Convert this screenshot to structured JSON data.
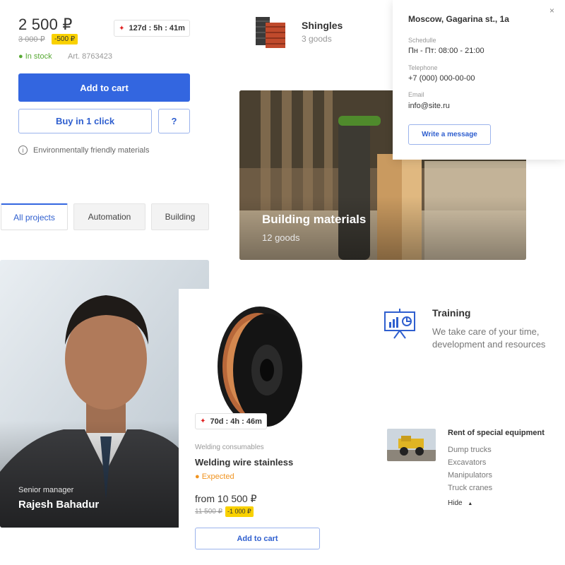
{
  "product": {
    "price": "2 500 ₽",
    "old_price": "3 000 ₽",
    "discount": "-500 ₽",
    "timer": "127d : 5h : 41m",
    "stock": "● In stock",
    "article": "Art. 8763423",
    "add_to_cart": "Add to cart",
    "buy_one_click": "Buy in 1 click",
    "question": "?",
    "eco_note": "Environmentally friendly materials"
  },
  "tabs": [
    {
      "label": "All projects",
      "active": true
    },
    {
      "label": "Automation",
      "active": false
    },
    {
      "label": "Building",
      "active": false
    }
  ],
  "shingles": {
    "title": "Shingles",
    "count": "3 goods"
  },
  "building_materials": {
    "title": "Building materials",
    "count": "12 goods"
  },
  "contact_popup": {
    "address": "Moscow, Gagarina st., 1a",
    "close": "×",
    "schedule_label": "Schedulle",
    "schedule_value": "Пн - Пт: 08:00 - 21:00",
    "phone_label": "Telephone",
    "phone_value": "+7 (000) 000-00-00",
    "email_label": "Email",
    "email_value": "info@site.ru",
    "button": "Write a message"
  },
  "person": {
    "role": "Senior manager",
    "name": "Rajesh Bahadur"
  },
  "welding": {
    "timer": "70d : 4h : 46m",
    "category": "Welding consumables",
    "name": "Welding wire stainless",
    "status": "● Expected",
    "price": "from 10 500 ₽",
    "old_price": "11 500 ₽",
    "discount": "-1 000 ₽",
    "add_to_cart": "Add to cart"
  },
  "training": {
    "title": "Training",
    "text": "We take care of your time, development and resources"
  },
  "rent": {
    "title": "Rent of special equipment",
    "items": [
      "Dump trucks",
      "Excavators",
      "Manipulators",
      "Truck cranes"
    ],
    "hide": "Hide"
  },
  "colors": {
    "accent": "#3366e0",
    "in_stock": "#58a934",
    "expected": "#f0931f",
    "discount_badge": "#f9d100",
    "timer_bolt": "#e02020"
  }
}
